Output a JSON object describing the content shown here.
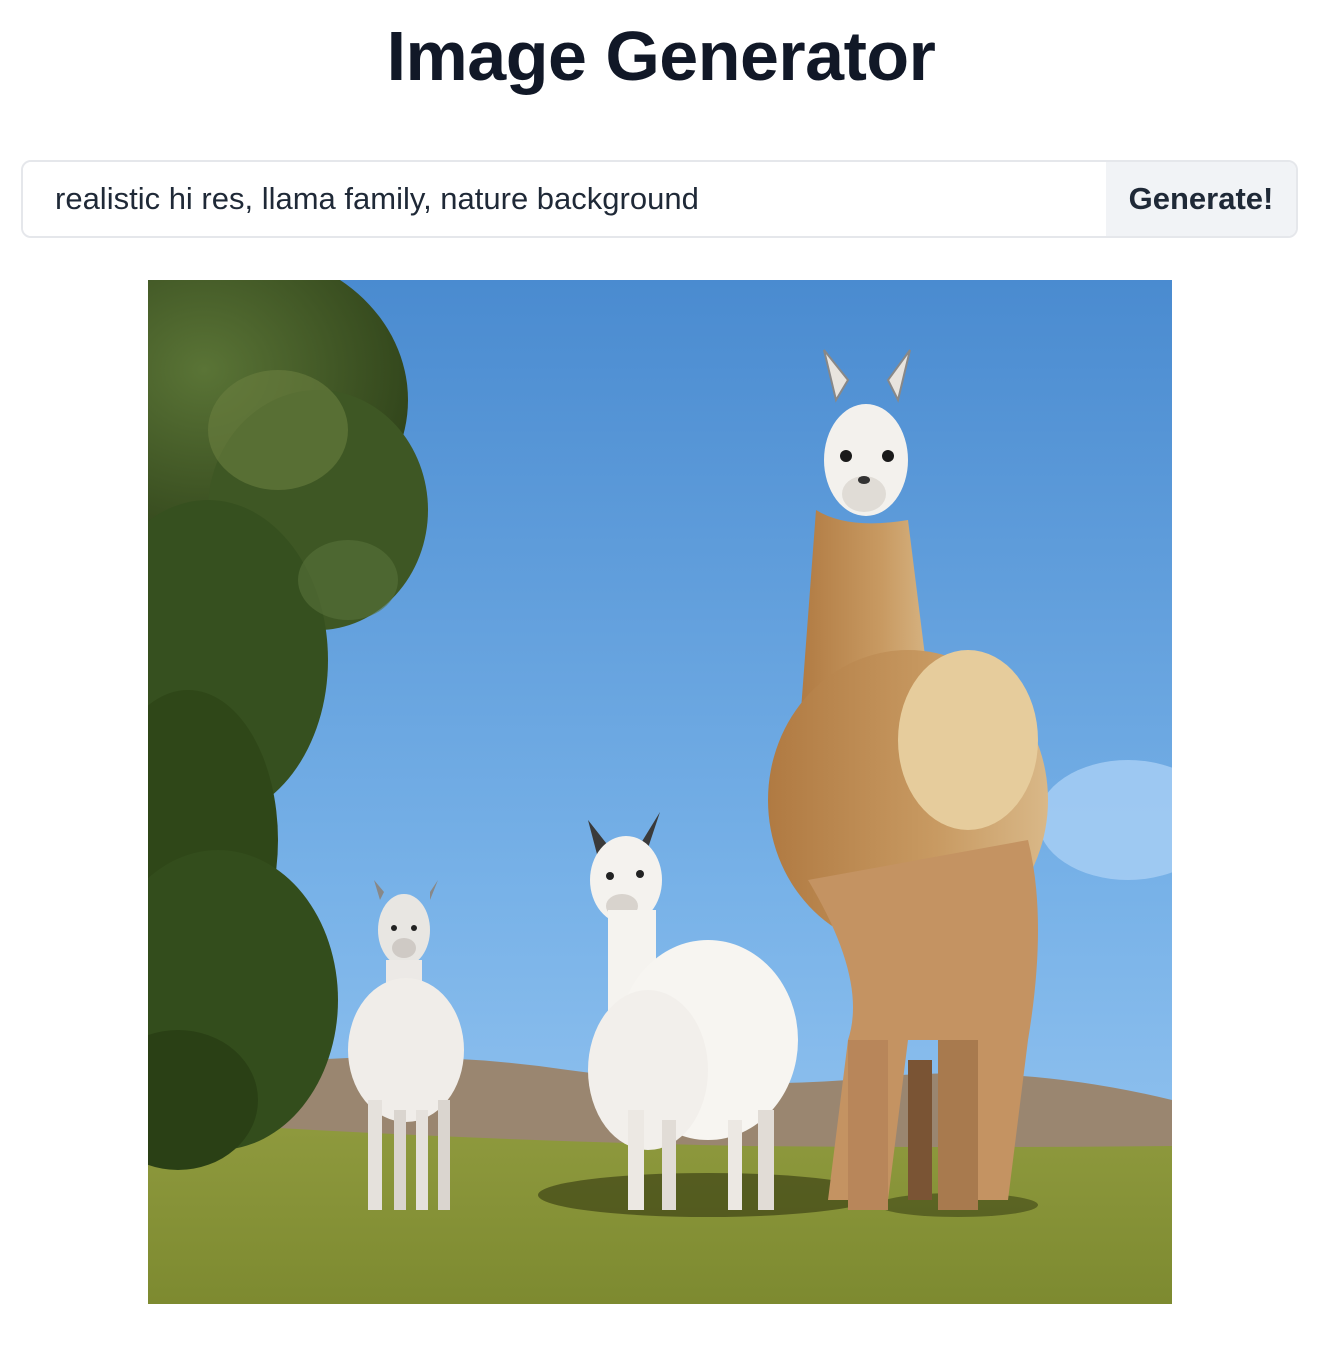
{
  "header": {
    "title": "Image Generator"
  },
  "prompt": {
    "value": "realistic hi res, llama family, nature background",
    "placeholder": ""
  },
  "actions": {
    "generate_label": "Generate!"
  },
  "result": {
    "alt": "realistic hi res, llama family, nature background"
  },
  "colors": {
    "title": "#111827",
    "button_bg": "#f1f3f6",
    "border": "#e5e7eb"
  }
}
